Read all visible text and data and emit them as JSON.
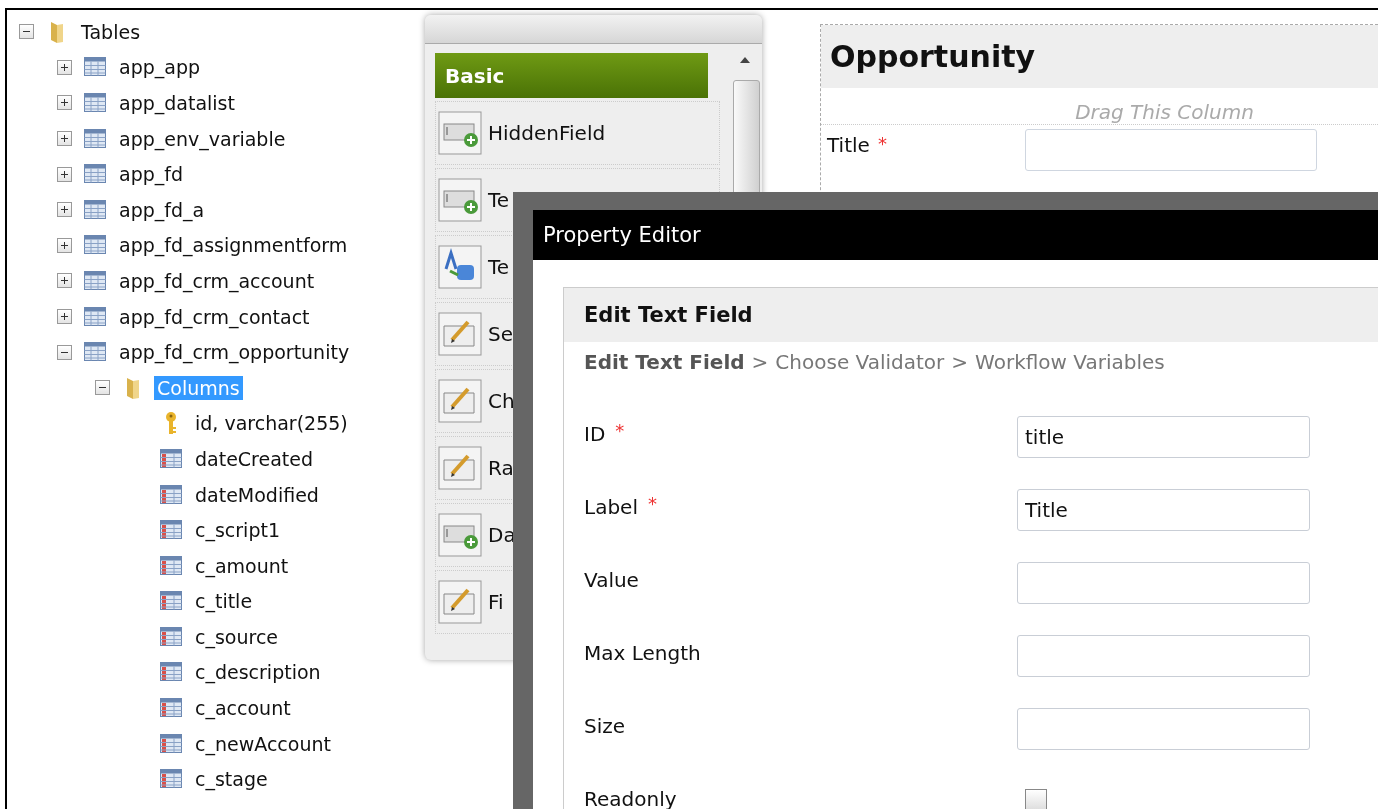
{
  "tree": [
    {
      "label": "Tables",
      "kind": "folder",
      "expanded": true,
      "selected": false,
      "children": [
        {
          "label": "app_app",
          "kind": "table",
          "expanded": false,
          "selected": false
        },
        {
          "label": "app_datalist",
          "kind": "table",
          "expanded": false,
          "selected": false
        },
        {
          "label": "app_env_variable",
          "kind": "table",
          "expanded": false,
          "selected": false
        },
        {
          "label": "app_fd",
          "kind": "table",
          "expanded": false,
          "selected": false
        },
        {
          "label": "app_fd_a",
          "kind": "table",
          "expanded": false,
          "selected": false
        },
        {
          "label": "app_fd_assignmentform",
          "kind": "table",
          "expanded": false,
          "selected": false
        },
        {
          "label": "app_fd_crm_account",
          "kind": "table",
          "expanded": false,
          "selected": false
        },
        {
          "label": "app_fd_crm_contact",
          "kind": "table",
          "expanded": false,
          "selected": false
        },
        {
          "label": "app_fd_crm_opportunity",
          "kind": "table",
          "expanded": true,
          "selected": false,
          "children": [
            {
              "label": "Columns",
              "kind": "folder",
              "expanded": true,
              "selected": true,
              "children": [
                {
                  "label": "id, varchar(255)",
                  "kind": "key",
                  "selected": false
                },
                {
                  "label": "dateCreated",
                  "kind": "column",
                  "selected": false
                },
                {
                  "label": "dateModified",
                  "kind": "column",
                  "selected": false
                },
                {
                  "label": "c_script1",
                  "kind": "column",
                  "selected": false
                },
                {
                  "label": "c_amount",
                  "kind": "column",
                  "selected": false
                },
                {
                  "label": "c_title",
                  "kind": "column",
                  "selected": false
                },
                {
                  "label": "c_source",
                  "kind": "column",
                  "selected": false
                },
                {
                  "label": "c_description",
                  "kind": "column",
                  "selected": false
                },
                {
                  "label": "c_account",
                  "kind": "column",
                  "selected": false
                },
                {
                  "label": "c_newAccount",
                  "kind": "column",
                  "selected": false
                },
                {
                  "label": "c_stage",
                  "kind": "column",
                  "selected": false
                }
              ]
            }
          ]
        }
      ]
    }
  ],
  "palette": {
    "header": "Basic",
    "items": [
      {
        "label": "HiddenField",
        "kind": "field"
      },
      {
        "label": "Te",
        "kind": "field"
      },
      {
        "label": "Te",
        "kind": "text"
      },
      {
        "label": "Se",
        "kind": "edit"
      },
      {
        "label": "Ch",
        "kind": "edit"
      },
      {
        "label": "Ra",
        "kind": "edit"
      },
      {
        "label": "Da",
        "kind": "field"
      },
      {
        "label": "Fi",
        "kind": "edit"
      }
    ]
  },
  "form_canvas": {
    "title": "Opportunity",
    "required_mark": "*",
    "column_hint": "Drag This Column",
    "fields": [
      {
        "label": "Title",
        "required": true
      }
    ]
  },
  "dialog": {
    "title": "Property Editor",
    "section_title": "Edit Text Field",
    "breadcrumb": [
      {
        "label": "Edit Text Field",
        "current": true
      },
      {
        "label": "Choose Validator",
        "current": false
      },
      {
        "label": "Workflow Variables",
        "current": false
      }
    ],
    "separator": ">",
    "required_mark": "*",
    "rows": [
      {
        "label": "ID",
        "required": true,
        "kind": "text",
        "value": "title"
      },
      {
        "label": "Label",
        "required": true,
        "kind": "text",
        "value": "Title"
      },
      {
        "label": "Value",
        "required": false,
        "kind": "text"
      },
      {
        "label": "Max Length",
        "required": false,
        "kind": "text"
      },
      {
        "label": "Size",
        "required": false,
        "kind": "text"
      },
      {
        "label": "Readonly",
        "required": false,
        "kind": "checkbox",
        "checked": false
      }
    ]
  }
}
